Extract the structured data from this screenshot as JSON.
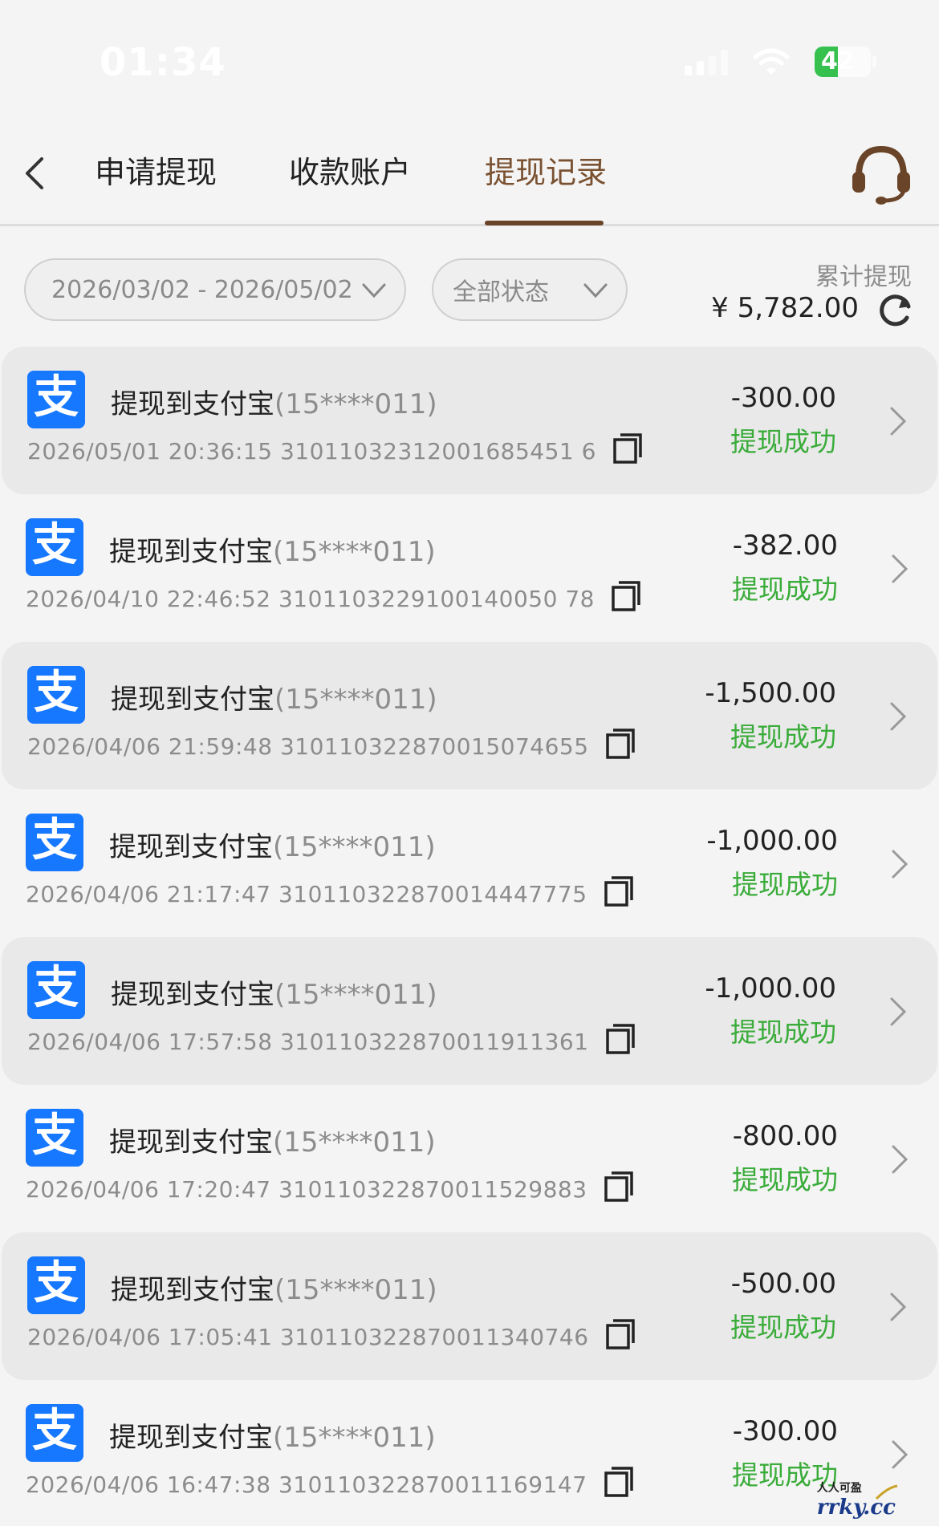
{
  "status_bar": {
    "time": "01:34",
    "battery": "42",
    "battery_level": 0.42
  },
  "nav": {
    "tabs": [
      {
        "label": "申请提现"
      },
      {
        "label": "收款账户"
      },
      {
        "label": "提现记录"
      }
    ],
    "active_tab": 2
  },
  "filters": {
    "date_range": "2026/03/02 - 2026/05/02",
    "status": "全部状态"
  },
  "summary": {
    "label": "累计提现",
    "value": "¥ 5,782.00"
  },
  "records": [
    {
      "title": "提现到支付宝",
      "account": "(15****011)",
      "datetime": "2026/05/01 20:36:15",
      "order_no": "31011032312001685451 6",
      "amount": "-300.00",
      "status": "提现成功"
    },
    {
      "title": "提现到支付宝",
      "account": "(15****011)",
      "datetime": "2026/04/10 22:46:52",
      "order_no": "3101103229100140050 78",
      "amount": "-382.00",
      "status": "提现成功"
    },
    {
      "title": "提现到支付宝",
      "account": "(15****011)",
      "datetime": "2026/04/06 21:59:48",
      "order_no": "310110322870015074655",
      "amount": "-1,500.00",
      "status": "提现成功"
    },
    {
      "title": "提现到支付宝",
      "account": "(15****011)",
      "datetime": "2026/04/06 21:17:47",
      "order_no": "310110322870014447775",
      "amount": "-1,000.00",
      "status": "提现成功"
    },
    {
      "title": "提现到支付宝",
      "account": "(15****011)",
      "datetime": "2026/04/06 17:57:58",
      "order_no": "310110322870011911361",
      "amount": "-1,000.00",
      "status": "提现成功"
    },
    {
      "title": "提现到支付宝",
      "account": "(15****011)",
      "datetime": "2026/04/06 17:20:47",
      "order_no": "310110322870011529883",
      "amount": "-800.00",
      "status": "提现成功"
    },
    {
      "title": "提现到支付宝",
      "account": "(15****011)",
      "datetime": "2026/04/06 17:05:41",
      "order_no": "310110322870011340746",
      "amount": "-500.00",
      "status": "提现成功"
    },
    {
      "title": "提现到支付宝",
      "account": "(15****011)",
      "datetime": "2026/04/06 16:47:38",
      "order_no": "310110322870011169147",
      "amount": "-300.00",
      "status": "提现成功"
    }
  ],
  "alipay_glyph": "支",
  "watermark": {
    "line1": "人人可盈",
    "line2": "rrky.cc"
  },
  "colors": {
    "accent": "#7a5232",
    "success": "#3aac3a",
    "alipay": "#1677ff"
  }
}
